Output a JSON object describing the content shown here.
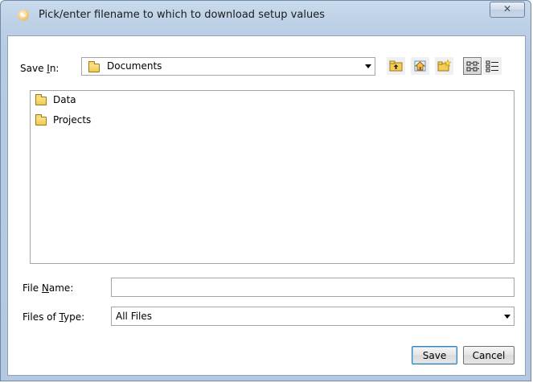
{
  "window": {
    "title": "Pick/enter filename to which to download setup values",
    "close_glyph": "✕"
  },
  "save_in": {
    "label_pre": "Save ",
    "label_key": "I",
    "label_post": "n:",
    "value": "Documents"
  },
  "toolbar": {
    "up_one_level": "up-folder-icon",
    "home": "home-icon",
    "new_folder": "new-folder-icon",
    "list_view": "list-view-icon",
    "details_view": "details-view-icon"
  },
  "file_list": {
    "items": [
      {
        "label": "Data",
        "icon": "folder-icon"
      },
      {
        "label": "Projects",
        "icon": "folder-icon"
      }
    ]
  },
  "file_name": {
    "label_pre": "File ",
    "label_key": "N",
    "label_post": "ame:",
    "value": ""
  },
  "files_of_type": {
    "label_pre": "Files of ",
    "label_key": "T",
    "label_post": "ype:",
    "value": "All Files"
  },
  "buttons": {
    "save": "Save",
    "cancel": "Cancel"
  }
}
